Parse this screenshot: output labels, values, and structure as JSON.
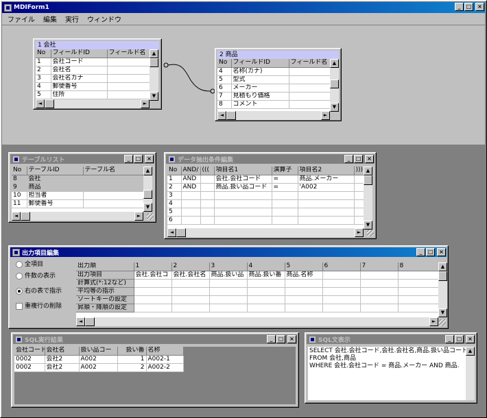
{
  "main": {
    "title": "MDIForm1",
    "menu": [
      "ファイル",
      "編集",
      "実行",
      "ウィンドウ"
    ]
  },
  "tables": [
    {
      "title": "1 会社",
      "headers": [
        "No",
        "フィールドID",
        "フィールド名"
      ],
      "rows": [
        [
          "1",
          "会社コード",
          ""
        ],
        [
          "2",
          "会社名",
          ""
        ],
        [
          "3",
          "会社名カナ",
          ""
        ],
        [
          "4",
          "郵便番号",
          ""
        ],
        [
          "5",
          "住所",
          ""
        ]
      ]
    },
    {
      "title": "2 商品",
      "headers": [
        "No",
        "フィールドID",
        "フィールド名"
      ],
      "rows": [
        [
          "4",
          "名称(カナ)",
          ""
        ],
        [
          "5",
          "型式",
          ""
        ],
        [
          "6",
          "メーカー",
          ""
        ],
        [
          "7",
          "見積もり価格",
          ""
        ],
        [
          "8",
          "コメント",
          ""
        ]
      ]
    }
  ],
  "table_list": {
    "title": "テーブルリスト",
    "headers": [
      "No",
      "テーブルID",
      "テーブル名"
    ],
    "rows": [
      [
        "8",
        "会社",
        ""
      ],
      [
        "9",
        "商品",
        ""
      ],
      [
        "10",
        "担当者",
        ""
      ],
      [
        "11",
        "郵便番号",
        ""
      ]
    ]
  },
  "extract": {
    "title": "データ抽出条件編集",
    "headers": [
      "No",
      "AND/",
      "(((",
      "項目名1",
      "演算子",
      "項目名2",
      ")))"
    ],
    "rows": [
      [
        "1",
        "AND",
        "",
        "会社.会社コード",
        "=",
        "商品.メーカー",
        ""
      ],
      [
        "2",
        "AND",
        "",
        "商品.扱い品コード",
        "=",
        "'A002",
        ""
      ],
      [
        "3",
        "",
        "",
        "",
        "",
        "",
        ""
      ],
      [
        "4",
        "",
        "",
        "",
        "",
        "",
        ""
      ],
      [
        "5",
        "",
        "",
        "",
        "",
        "",
        ""
      ],
      [
        "6",
        "",
        "",
        "",
        "",
        "",
        ""
      ]
    ]
  },
  "output": {
    "title": "出力項目編集",
    "options": [
      "全項目",
      "件数の表示",
      "右の表で指示"
    ],
    "selected_option": 2,
    "dedupe_label": "重複行の削除",
    "col_headers": [
      "1",
      "2",
      "3",
      "4",
      "5",
      "6",
      "7",
      "8"
    ],
    "row_labels": [
      "出力順",
      "出力項目",
      "計算式(*:12など)",
      "平均等の指示",
      "ソートキーの設定",
      "昇順・降順の設定"
    ],
    "cells": [
      [
        "会社.会社コ",
        "会社.会社名",
        "商品.扱い品",
        "商品.扱い番",
        "商品.名称",
        "",
        "",
        ""
      ]
    ]
  },
  "results": {
    "title": "SQL実行結果",
    "headers": [
      "会社コード",
      "会社名",
      "扱い品コー",
      "扱い番",
      "名称"
    ],
    "rows": [
      [
        "0002",
        "会社2",
        "A002",
        "1",
        "A002-1"
      ],
      [
        "0002",
        "会社2",
        "A002",
        "2",
        "A002-2"
      ]
    ]
  },
  "sql": {
    "title": "SQL文表示",
    "lines": [
      "SELECT 会社.会社コード,会社.会社名,商品.扱い品コード",
      "FROM 会社,商品",
      "WHERE  会社.会社コード = 商品.メーカー  AND  商品."
    ]
  }
}
